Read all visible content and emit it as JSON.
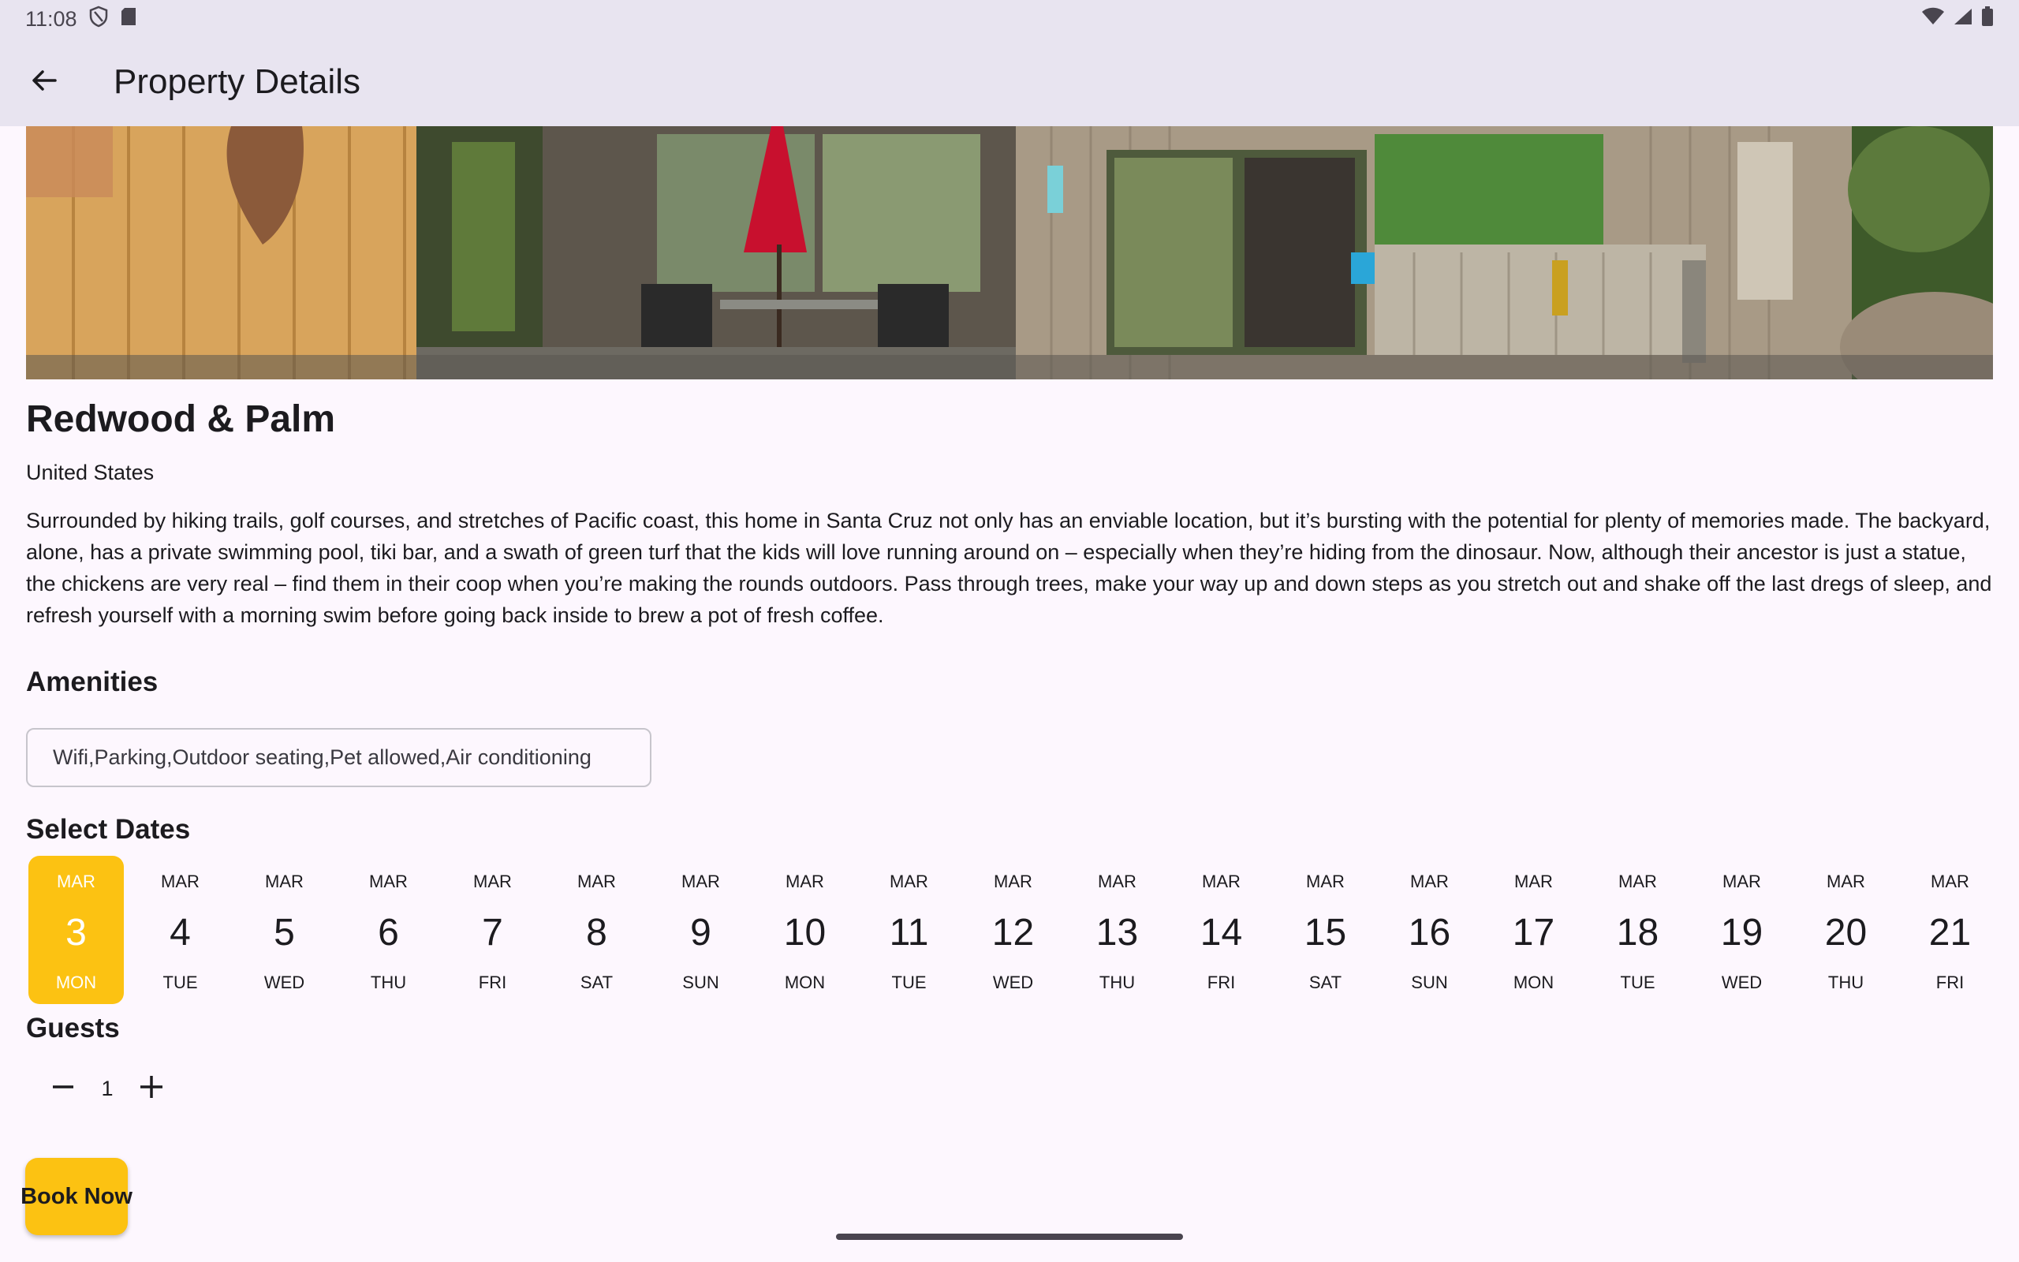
{
  "status_bar": {
    "time": "11:08"
  },
  "app_bar": {
    "title": "Property Details"
  },
  "property": {
    "name": "Redwood & Palm",
    "country": "United States",
    "description": "Surrounded by hiking trails, golf courses, and stretches of Pacific coast, this home in Santa Cruz not only has an enviable location, but it’s bursting with the potential for plenty of memories made. The backyard, alone, has a private swimming pool, tiki bar, and a swath of green turf that the kids will love running around on – especially when they’re hiding from the dinosaur. Now, although their ancestor is just a statue, the chickens are very real – find them in their coop when you’re making the rounds outdoors. Pass through trees, make your way up and down steps as you stretch out and shake off the last dregs of sleep, and refresh yourself with a morning swim before going back inside to brew a pot of fresh coffee."
  },
  "amenities": {
    "heading": "Amenities",
    "value": "Wifi,Parking,Outdoor seating,Pet allowed,Air conditioning"
  },
  "dates": {
    "heading": "Select Dates",
    "selected_index": 0,
    "items": [
      {
        "month": "MAR",
        "day": "3",
        "weekday": "MON"
      },
      {
        "month": "MAR",
        "day": "4",
        "weekday": "TUE"
      },
      {
        "month": "MAR",
        "day": "5",
        "weekday": "WED"
      },
      {
        "month": "MAR",
        "day": "6",
        "weekday": "THU"
      },
      {
        "month": "MAR",
        "day": "7",
        "weekday": "FRI"
      },
      {
        "month": "MAR",
        "day": "8",
        "weekday": "SAT"
      },
      {
        "month": "MAR",
        "day": "9",
        "weekday": "SUN"
      },
      {
        "month": "MAR",
        "day": "10",
        "weekday": "MON"
      },
      {
        "month": "MAR",
        "day": "11",
        "weekday": "TUE"
      },
      {
        "month": "MAR",
        "day": "12",
        "weekday": "WED"
      },
      {
        "month": "MAR",
        "day": "13",
        "weekday": "THU"
      },
      {
        "month": "MAR",
        "day": "14",
        "weekday": "FRI"
      },
      {
        "month": "MAR",
        "day": "15",
        "weekday": "SAT"
      },
      {
        "month": "MAR",
        "day": "16",
        "weekday": "SUN"
      },
      {
        "month": "MAR",
        "day": "17",
        "weekday": "MON"
      },
      {
        "month": "MAR",
        "day": "18",
        "weekday": "TUE"
      },
      {
        "month": "MAR",
        "day": "19",
        "weekday": "WED"
      },
      {
        "month": "MAR",
        "day": "20",
        "weekday": "THU"
      },
      {
        "month": "MAR",
        "day": "21",
        "weekday": "FRI"
      }
    ]
  },
  "guests": {
    "heading": "Guests",
    "count": "1"
  },
  "actions": {
    "book_label": "Book Now"
  },
  "colors": {
    "accent": "#fcc212",
    "app_bar_bg": "#e8e4f0",
    "page_bg": "#fdf7fe"
  },
  "icons": {
    "back": "arrow-left-icon",
    "minus": "minus-icon",
    "plus": "plus-icon",
    "shield": "shield-icon",
    "sd_card": "sd-card-icon",
    "wifi": "wifi-icon",
    "signal": "signal-icon",
    "battery": "battery-icon"
  }
}
